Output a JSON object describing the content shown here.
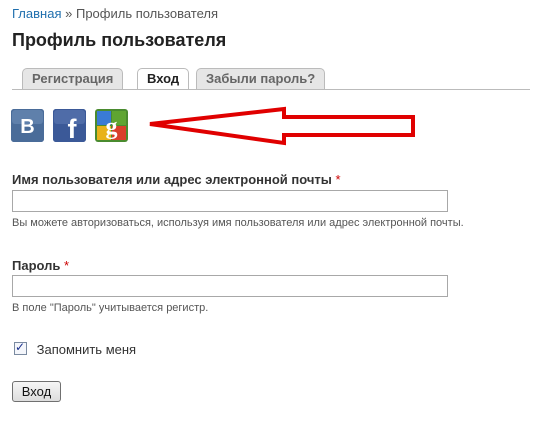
{
  "breadcrumb": {
    "home": "Главная",
    "separator": "»",
    "current": "Профиль пользователя"
  },
  "page_title": "Профиль пользователя",
  "tabs": [
    {
      "label": "Регистрация",
      "active": false
    },
    {
      "label": "Вход",
      "active": true
    },
    {
      "label": "Забыли пароль?",
      "active": false
    }
  ],
  "social": [
    {
      "letter": "B",
      "icon": "vkontakte-icon",
      "color": "#4a6c99"
    },
    {
      "letter": "f",
      "icon": "facebook-icon",
      "color": "#3b5998"
    },
    {
      "letter": "g",
      "icon": "google-icon",
      "color": "#4a8b2f"
    }
  ],
  "annotation": {
    "icon": "red-arrow-left",
    "color": "#e00000"
  },
  "username": {
    "label": "Имя пользователя или адрес электронной почты",
    "required_mark": "*",
    "value": "",
    "description": "Вы можете авторизоваться, используя имя пользователя или адрес электронной почты."
  },
  "password": {
    "label": "Пароль",
    "required_mark": "*",
    "value": "",
    "description": "В поле \"Пароль\" учитывается регистр."
  },
  "remember": {
    "label": "Запомнить меня",
    "checked": true,
    "check_glyph": "✓"
  },
  "submit_label": "Вход"
}
